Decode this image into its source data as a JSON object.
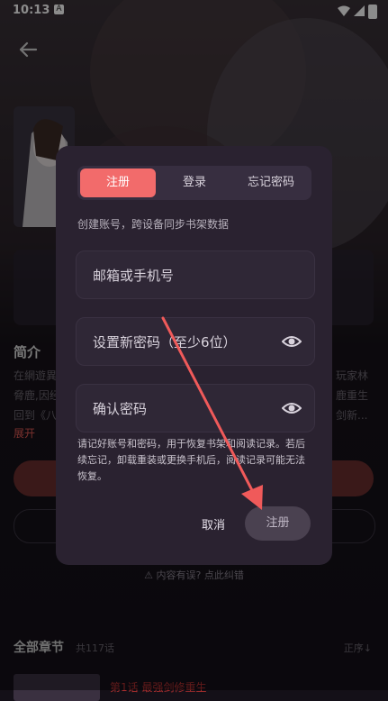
{
  "status_bar": {
    "time": "10:13",
    "notification": "A"
  },
  "page": {
    "intro_title": "简介",
    "intro_lines": [
      "在網遊異",
      "脅鹿,因经",
      "回到《八",
      "玩家林",
      "鹿重生",
      "剑新..."
    ],
    "expand_label": "展开",
    "report_label": "内容有误? 点此纠错",
    "chapters_title": "全部章节",
    "chapters_count": "共117话",
    "sort_label": "正序",
    "first_chapter": "第1话 最强剑修重生"
  },
  "dialog": {
    "tabs": [
      {
        "label": "注册",
        "active": true
      },
      {
        "label": "登录",
        "active": false
      },
      {
        "label": "忘记密码",
        "active": false
      }
    ],
    "subtitle": "创建账号，跨设备同步书架数据",
    "fields": {
      "account_placeholder": "邮箱或手机号",
      "password_placeholder": "设置新密码（至少6位）",
      "confirm_placeholder": "确认密码"
    },
    "notice": "请记好账号和密码，用于恢复书架和阅读记录。若后续忘记，卸载重装或更换手机后，阅读记录可能无法恢复。",
    "cancel_label": "取消",
    "submit_label": "注册"
  },
  "colors": {
    "accent": "#f26b6b",
    "dialog_bg": "#2a2230",
    "annotation_arrow": "#f05a5a"
  }
}
